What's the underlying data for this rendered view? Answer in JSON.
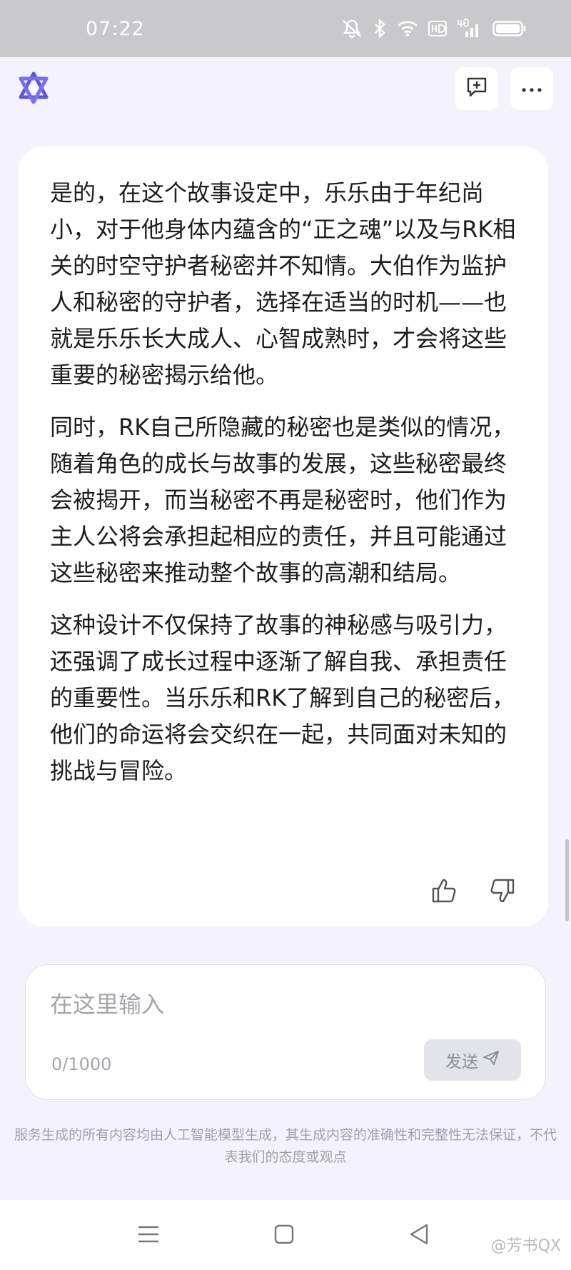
{
  "status_bar": {
    "time": "07:22"
  },
  "message": {
    "paragraphs": [
      "是的，在这个故事设定中，乐乐由于年纪尚小，对于他身体内蕴含的“正之魂”以及与RK相关的时空守护者秘密并不知情。大伯作为监护人和秘密的守护者，选择在适当的时机——也就是乐乐长大成人、心智成熟时，才会将这些重要的秘密揭示给他。",
      "同时，RK自己所隐藏的秘密也是类似的情况，随着角色的成长与故事的发展，这些秘密最终会被揭开，而当秘密不再是秘密时，他们作为主人公将会承担起相应的责任，并且可能通过这些秘密来推动整个故事的高潮和结局。",
      "这种设计不仅保持了故事的神秘感与吸引力，还强调了成长过程中逐渐了解自我、承担责任的重要性。当乐乐和RK了解到自己的秘密后，他们的命运将会交织在一起，共同面对未知的挑战与冒险。"
    ]
  },
  "input": {
    "placeholder": "在这里输入",
    "value": "",
    "char_count": "0/1000",
    "send_label": "发送"
  },
  "disclaimer": "服务生成的所有内容均由人工智能模型生成，其生成内容的准确性和完整性无法保证，不代表我们的态度或观点",
  "watermark": "@芳书QX",
  "colors": {
    "accent": "#5b5bd6",
    "background": "#f4f3fb",
    "card": "#ffffff",
    "status_bar": "#c9c9cb"
  }
}
